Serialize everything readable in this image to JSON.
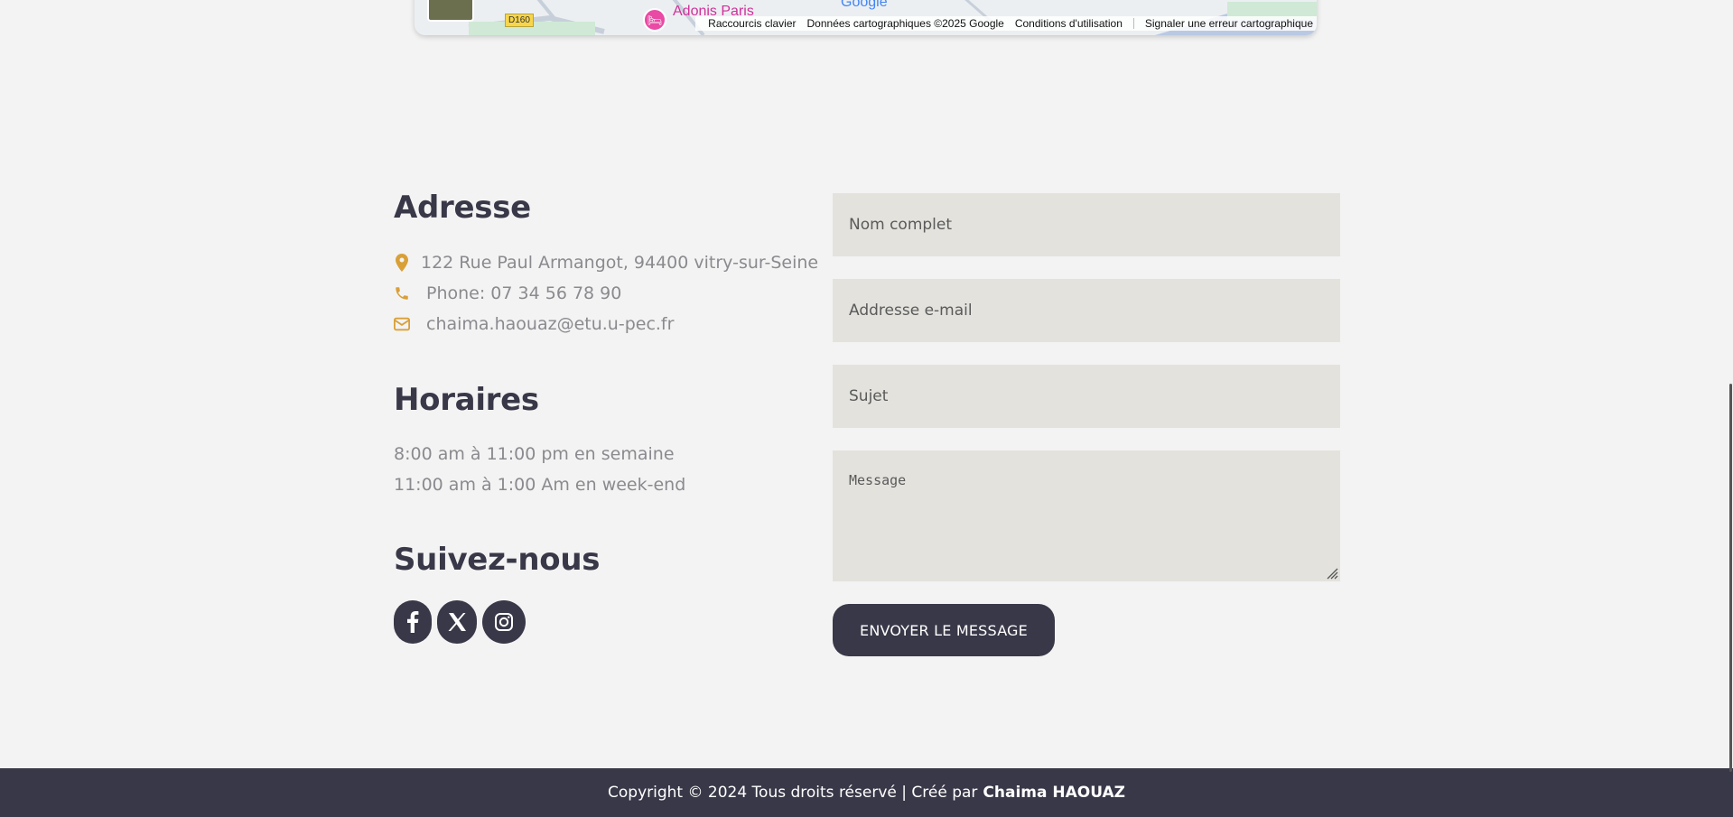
{
  "map": {
    "road_label": "D160",
    "poi_name": "Adonis Paris",
    "logo_text": "Google",
    "footer_links": [
      "Raccourcis clavier",
      "Données cartographiques ©2025 Google",
      "Conditions d'utilisation",
      "Signaler une erreur cartographique"
    ]
  },
  "contact": {
    "address_title": "Adresse",
    "address": "122 Rue Paul Armangot, 94400 vitry-sur-Seine",
    "phone": "Phone: 07 34 56 78 90",
    "email": "chaima.haouaz@etu.u-pec.fr",
    "hours_title": "Horaires",
    "hours": [
      "8:00 am à 11:00 pm en semaine",
      "11:00 am à 1:00 Am en week-end"
    ],
    "follow_title": "Suivez-nous",
    "socials": [
      "facebook-icon",
      "x-icon",
      "instagram-icon"
    ]
  },
  "form": {
    "name_placeholder": "Nom complet",
    "email_placeholder": "Addresse e-mail",
    "subject_placeholder": "Sujet",
    "message_placeholder": "Message",
    "submit_label": "ENVOYER LE MESSAGE"
  },
  "footer": {
    "text": "Copyright © 2024 Tous droits réservé | Créé par",
    "author": "Chaima HAOUAZ"
  },
  "colors": {
    "accent": "#d9a038",
    "dark": "#393848",
    "background": "#f3f3f3",
    "field_bg": "#e3e2dd"
  }
}
